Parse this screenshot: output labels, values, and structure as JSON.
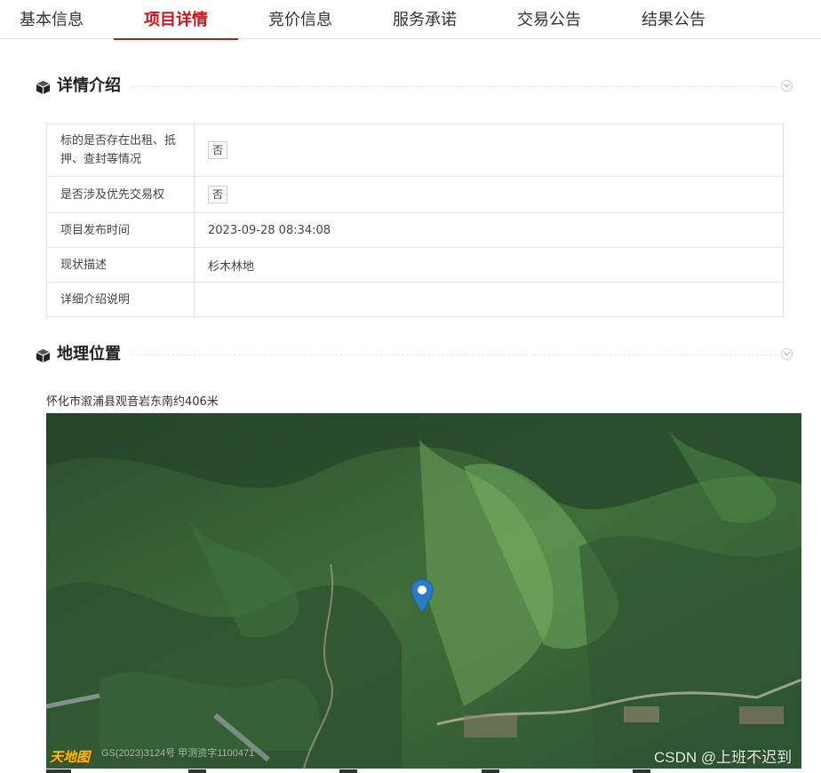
{
  "tabs": [
    {
      "label": "基本信息",
      "active": false
    },
    {
      "label": "项目详情",
      "active": true
    },
    {
      "label": "竞价信息",
      "active": false
    },
    {
      "label": "服务承诺",
      "active": false
    },
    {
      "label": "交易公告",
      "active": false
    },
    {
      "label": "结果公告",
      "active": false
    }
  ],
  "details": {
    "title": "详情介绍",
    "rows": [
      {
        "label": "标的是否存在出租、抵押、查封等情况",
        "value": "否",
        "badge": true
      },
      {
        "label": "是否涉及优先交易权",
        "value": "否",
        "badge": true
      },
      {
        "label": "项目发布时间",
        "value": "2023-09-28 08:34:08",
        "badge": false
      },
      {
        "label": "现状描述",
        "value": "杉木林地",
        "badge": false
      },
      {
        "label": "详细介绍说明",
        "value": "",
        "badge": false
      }
    ]
  },
  "location": {
    "title": "地理位置",
    "address": "怀化市溆浦县观音岩东南约406米",
    "map_logo": "天地图",
    "map_copyright": "GS(2023)3124号 甲测资字1100471"
  },
  "watermark": "CSDN @上班不迟到",
  "colors": {
    "accent": "#c8161d",
    "pin": "#2b7cc4",
    "border": "#e2e2e2"
  }
}
